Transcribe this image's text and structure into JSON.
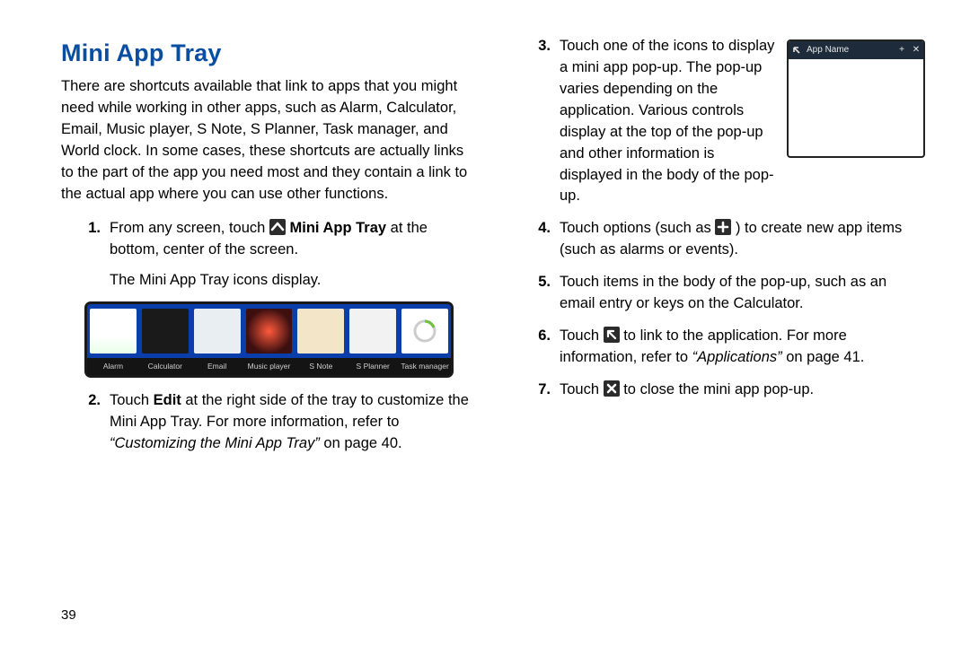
{
  "page_number": "39",
  "heading": "Mini App Tray",
  "intro": "There are shortcuts available that link to apps that you might need while working in other apps, such as Alarm, Calculator, Email, Music player, S Note, S Planner, Task manager, and World clock. In some cases, these shortcuts are actually links to the part of the app you need most and they contain a link to the actual app where you can use other functions.",
  "left_steps": {
    "s1_num": "1.",
    "s1_a": "From any screen, touch ",
    "s1_b": " Mini App Tray",
    "s1_c": " at the bottom, center of the screen.",
    "s1_sub": "The Mini App Tray icons display.",
    "s2_num": "2.",
    "s2_a": "Touch ",
    "s2_b": "Edit",
    "s2_c": " at the right side of the tray to customize the Mini App Tray. For more information, refer to ",
    "s2_d": "“Customizing the Mini App Tray”",
    "s2_e": " on page 40."
  },
  "tray_labels": [
    "Alarm",
    "Calculator",
    "Email",
    "Music player",
    "S Note",
    "S Planner",
    "Task manager"
  ],
  "popup": {
    "title": "App Name"
  },
  "right_steps": {
    "s3_num": "3.",
    "s3": "Touch one of the icons to display a mini app pop-up. The pop-up varies depending on the application. Various controls display at the top of the pop-up and other information is displayed in the body of the pop-up.",
    "s4_num": "4.",
    "s4_a": "Touch options (such as ",
    "s4_b": ") to create new app items (such as alarms or events).",
    "s5_num": "5.",
    "s5": "Touch items in the body of the pop-up, such as an email entry or keys on the Calculator.",
    "s6_num": "6.",
    "s6_a": "Touch ",
    "s6_b": " to link to the application. For more information, refer to ",
    "s6_c": "“Applications”",
    "s6_d": " on page 41.",
    "s7_num": "7.",
    "s7_a": "Touch ",
    "s7_b": " to close the mini app pop-up."
  },
  "icons": {
    "chevron": "^",
    "plus": "+",
    "link": "↖",
    "close": "✕"
  }
}
